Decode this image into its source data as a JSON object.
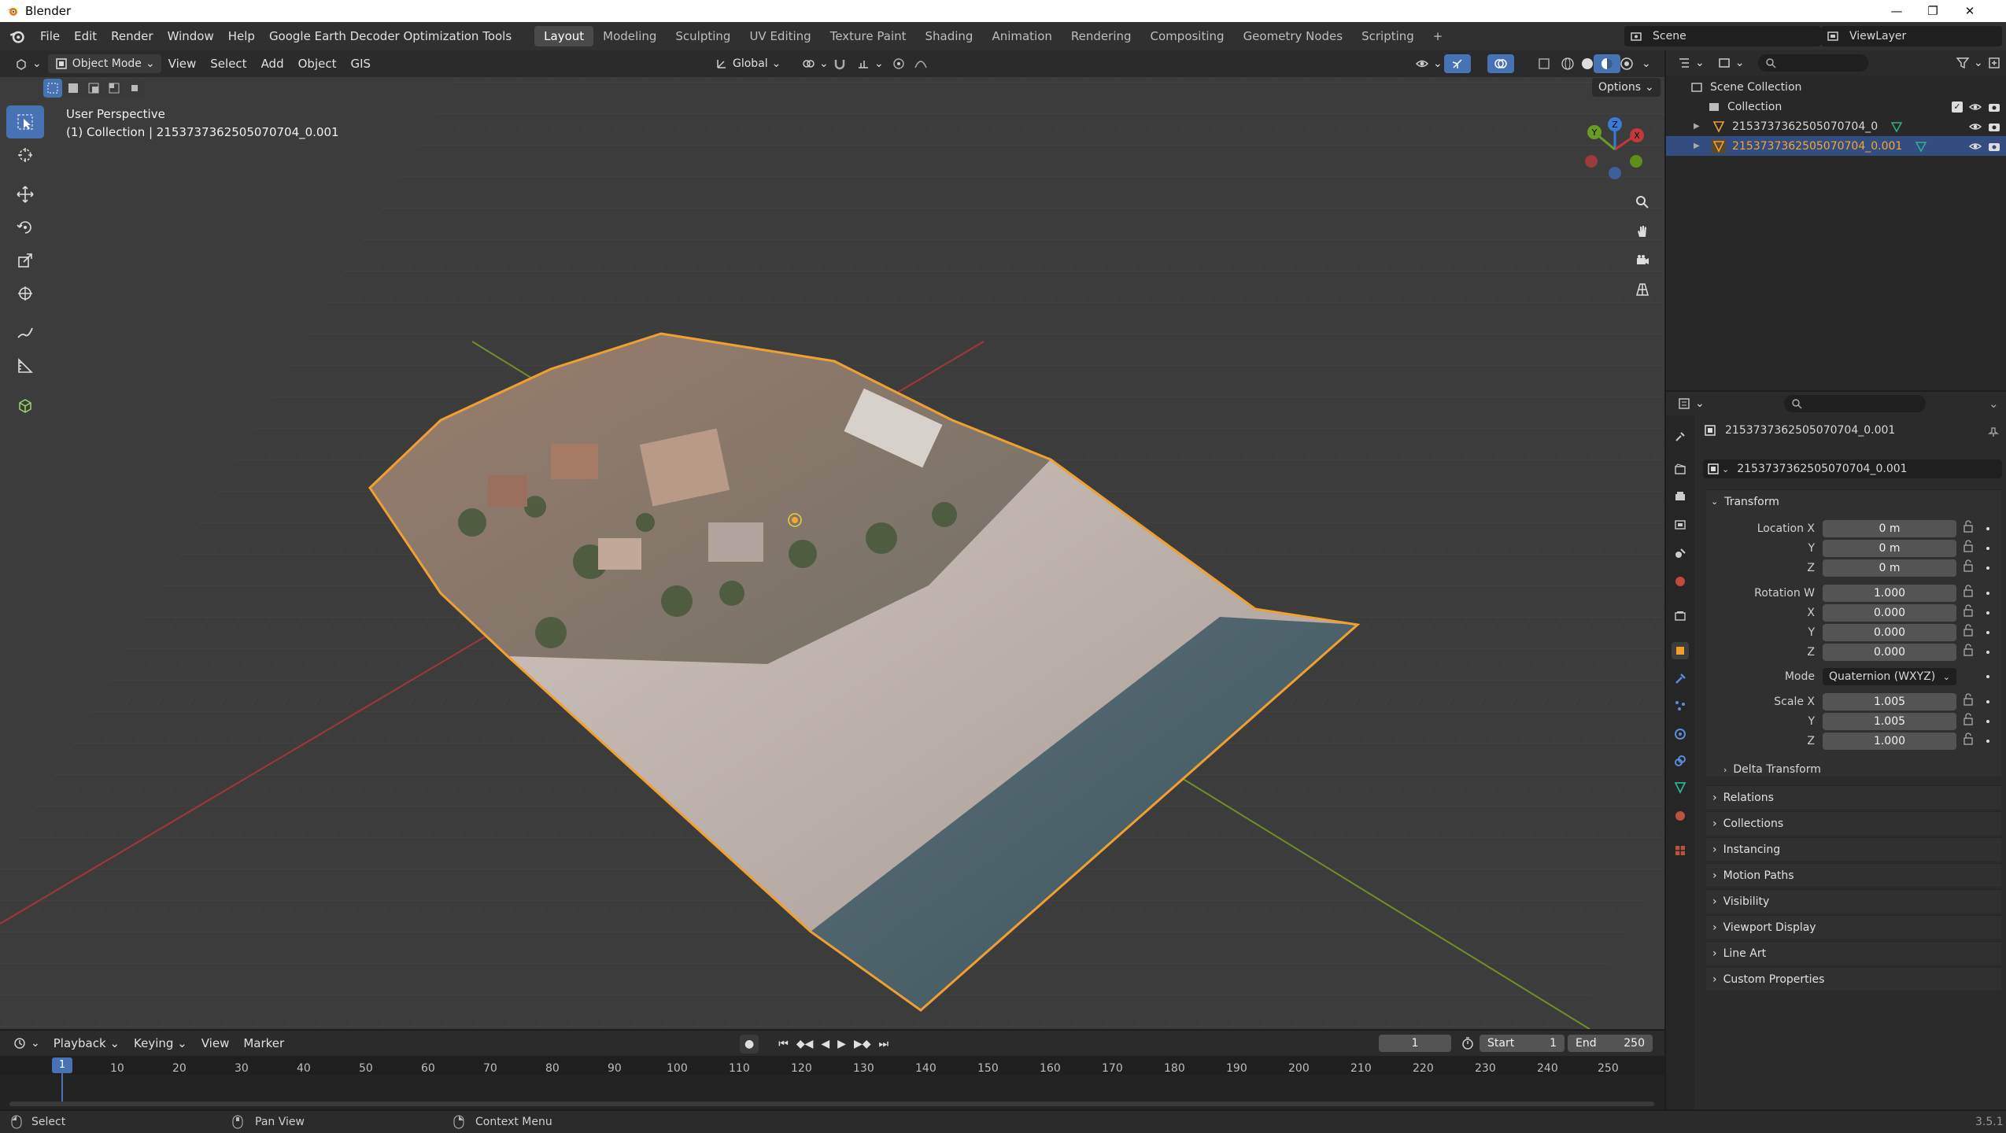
{
  "window": {
    "title": "Blender"
  },
  "menus": [
    "File",
    "Edit",
    "Render",
    "Window",
    "Help",
    "Google Earth Decoder Optimization Tools"
  ],
  "workspaces": [
    {
      "label": "Layout",
      "active": true
    },
    {
      "label": "Modeling"
    },
    {
      "label": "Sculpting"
    },
    {
      "label": "UV Editing"
    },
    {
      "label": "Texture Paint"
    },
    {
      "label": "Shading"
    },
    {
      "label": "Animation"
    },
    {
      "label": "Rendering"
    },
    {
      "label": "Compositing"
    },
    {
      "label": "Geometry Nodes"
    },
    {
      "label": "Scripting"
    }
  ],
  "top_right": {
    "scene": "Scene",
    "view_layer": "ViewLayer"
  },
  "viewport_header": {
    "mode": "Object Mode",
    "menus": [
      "View",
      "Select",
      "Add",
      "Object",
      "GIS"
    ],
    "orientation": "Global",
    "options": "Options"
  },
  "viewport": {
    "perspective": "User Perspective",
    "context": "(1) Collection | 2153737362505070704_0.001",
    "gizmo": {
      "x": "X",
      "y": "Y",
      "z": "Z"
    }
  },
  "outliner": {
    "scene_collection": "Scene Collection",
    "collection": "Collection",
    "objects": [
      {
        "name": "2153737362505070704_0",
        "selected": false
      },
      {
        "name": "2153737362505070704_0.001",
        "selected": true
      }
    ]
  },
  "properties": {
    "object_name": "2153737362505070704_0.001",
    "datablock": "2153737362505070704_0.001",
    "transform": {
      "title": "Transform",
      "location_label": "Location X",
      "location": [
        "0 m",
        "0 m",
        "0 m"
      ],
      "rotation_label": "Rotation W",
      "rotation": [
        "1.000",
        "0.000",
        "0.000",
        "0.000"
      ],
      "mode_label": "Mode",
      "mode": "Quaternion (WXYZ)",
      "scale_label": "Scale X",
      "scale": [
        "1.005",
        "1.005",
        "1.000"
      ],
      "axis_labels": [
        "X",
        "Y",
        "Z",
        "W"
      ]
    },
    "subpanels": {
      "delta": "Delta Transform",
      "relations": "Relations",
      "collections": "Collections",
      "instancing": "Instancing",
      "motion_paths": "Motion Paths",
      "visibility": "Visibility",
      "viewport_display": "Viewport Display",
      "line_art": "Line Art",
      "custom_properties": "Custom Properties"
    }
  },
  "timeline": {
    "menus": [
      "Playback",
      "Keying",
      "View",
      "Marker"
    ],
    "current_frame": "1",
    "start_label": "Start",
    "start": "1",
    "end_label": "End",
    "end": "250",
    "playhead": "1",
    "ticks": [
      "10",
      "20",
      "30",
      "40",
      "50",
      "60",
      "70",
      "80",
      "90",
      "100",
      "110",
      "120",
      "130",
      "140",
      "150",
      "160",
      "170",
      "180",
      "190",
      "200",
      "210",
      "220",
      "230",
      "240",
      "250"
    ]
  },
  "statusbar": {
    "select": "Select",
    "pan": "Pan View",
    "context": "Context Menu",
    "version": "3.5.1"
  },
  "colors": {
    "accent": "#4772b3",
    "selection_outline": "#f0a030",
    "axis_x": "#c0393b",
    "axis_y": "#6a9c22",
    "active_object": "#f6a632"
  }
}
